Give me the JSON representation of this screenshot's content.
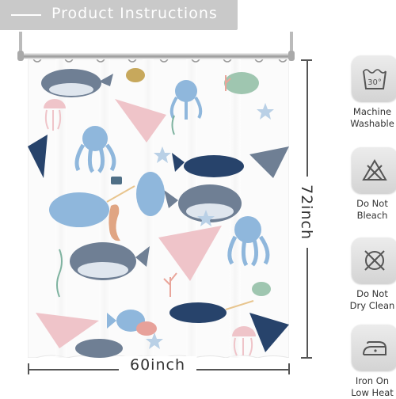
{
  "header": {
    "title": "Product Instructions"
  },
  "dimensions": {
    "width": "60inch",
    "height": "72inch"
  },
  "care": [
    {
      "icon": "machine-wash-30-icon",
      "line1": "Machine",
      "line2": "Washable"
    },
    {
      "icon": "do-not-bleach-icon",
      "line1": "Do Not",
      "line2": "Bleach"
    },
    {
      "icon": "do-not-dry-clean-icon",
      "line1": "Do Not",
      "line2": "Dry Clean"
    },
    {
      "icon": "iron-low-heat-icon",
      "line1": "Iron On",
      "line2": "Low Heat"
    }
  ],
  "wash_temp": "30°",
  "colors": {
    "banner": "#c9c9c9",
    "whale": "#6f7f94",
    "navy": "#27436b",
    "pink": "#efc4c9",
    "blue": "#8fb7dc"
  }
}
